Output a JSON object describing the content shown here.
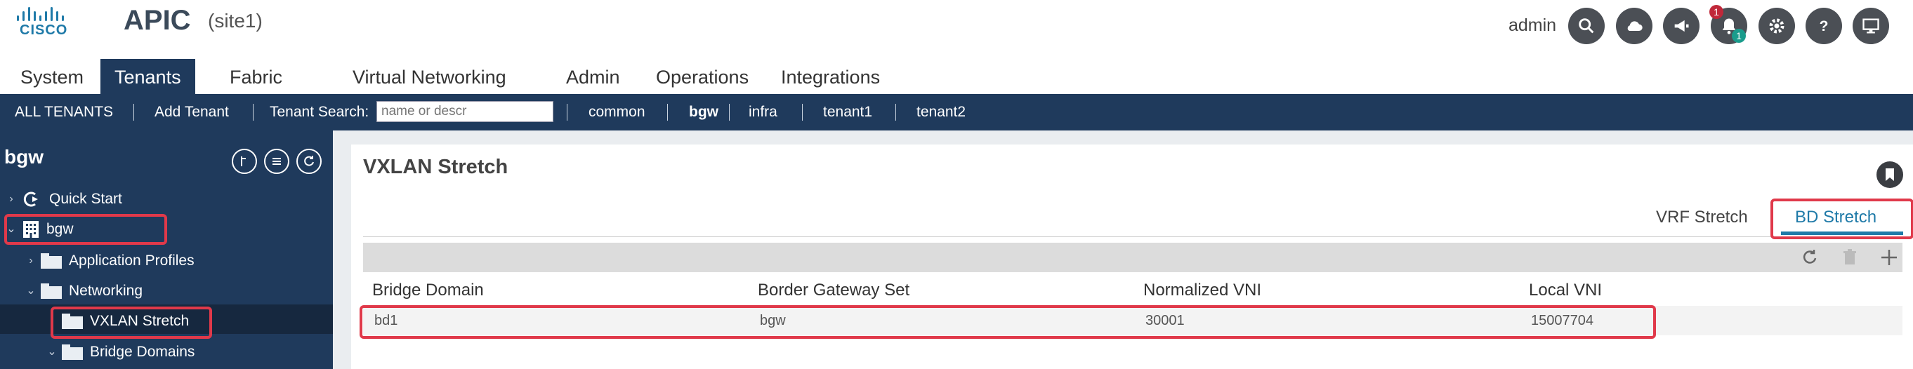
{
  "header": {
    "brand": "CISCO",
    "title": "APIC",
    "site": "(site1)",
    "user": "admin",
    "alerts_count": "1",
    "notifications_count": "1"
  },
  "tabs": [
    "System",
    "Tenants",
    "Fabric",
    "Virtual Networking",
    "Admin",
    "Operations",
    "Integrations"
  ],
  "active_tab": "Tenants",
  "navbar": {
    "all_tenants": "ALL TENANTS",
    "add_tenant": "Add Tenant",
    "search_label": "Tenant Search:",
    "search_placeholder": "name or descr",
    "tenants": [
      "common",
      "bgw",
      "infra",
      "tenant1",
      "tenant2"
    ]
  },
  "sidebar": {
    "title": "bgw",
    "items": [
      {
        "label": "Quick Start"
      },
      {
        "label": "bgw"
      },
      {
        "label": "Application Profiles"
      },
      {
        "label": "Networking"
      },
      {
        "label": "VXLAN Stretch"
      },
      {
        "label": "Bridge Domains"
      }
    ]
  },
  "main": {
    "title": "VXLAN Stretch",
    "tabs": [
      "VRF Stretch",
      "BD Stretch"
    ],
    "active_tab": "BD Stretch",
    "table": {
      "columns": [
        "Bridge Domain",
        "Border Gateway Set",
        "Normalized VNI",
        "Local VNI"
      ],
      "rows": [
        [
          "bd1",
          "bgw",
          "30001",
          "15007704"
        ]
      ]
    }
  },
  "colors": {
    "navy": "#1f3a5c",
    "highlight": "#e0394a",
    "active_tab_blue": "#1f7aa8"
  }
}
